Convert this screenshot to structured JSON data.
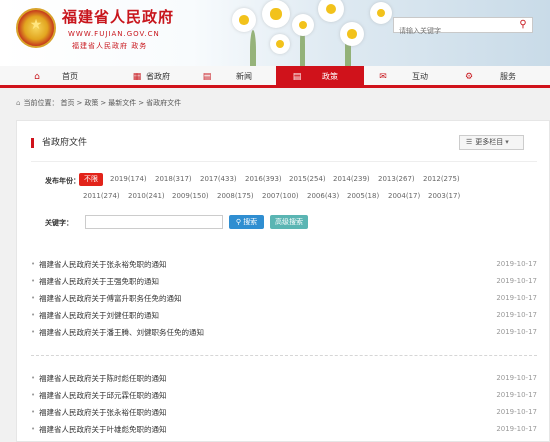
{
  "header": {
    "title": "福建省人民政府",
    "url_text": "WWW.FUJIAN.GOV.CN",
    "subtitle": "福建省人民政府 政务",
    "search_placeholder": "请输入关键字",
    "accent_color": "#d0121b"
  },
  "nav": [
    {
      "label": "首页",
      "icon": "home-icon"
    },
    {
      "label": "省政府",
      "icon": "building-icon"
    },
    {
      "label": "新闻",
      "icon": "news-icon"
    },
    {
      "label": "政策",
      "icon": "policy-icon",
      "active": true
    },
    {
      "label": "互动",
      "icon": "chat-icon"
    },
    {
      "label": "服务",
      "icon": "service-icon"
    }
  ],
  "breadcrumb": {
    "prefix": "当前位置：",
    "items": [
      "首页",
      ">",
      "政策",
      ">",
      "最新文件",
      ">",
      "省政府文件"
    ]
  },
  "panel": {
    "title": "省政府文件",
    "more_label": "更多栏目",
    "filter_label": "发布年份：",
    "years_row1": [
      "不限",
      "2019(174)",
      "2018(317)",
      "2017(433)",
      "2016(393)",
      "2015(254)",
      "2014(239)",
      "2013(267)",
      "2012(275)"
    ],
    "years_row2": [
      "2011(274)",
      "2010(241)",
      "2009(150)",
      "2008(175)",
      "2007(100)",
      "2006(43)",
      "2005(18)",
      "2004(17)",
      "2003(17)"
    ],
    "keyword_label": "关键字：",
    "search_btn": "搜索",
    "advanced_btn": "高级搜索"
  },
  "list_group1": [
    {
      "title": "福建省人民政府关于张永裕免职的通知",
      "date": "2019-10-17"
    },
    {
      "title": "福建省人民政府关于王强免职的通知",
      "date": "2019-10-17"
    },
    {
      "title": "福建省人民政府关于傅富升职务任免的通知",
      "date": "2019-10-17"
    },
    {
      "title": "福建省人民政府关于刘健任职的通知",
      "date": "2019-10-17"
    },
    {
      "title": "福建省人民政府关于潘王腾、刘健职务任免的通知",
      "date": "2019-10-17"
    }
  ],
  "list_group2": [
    {
      "title": "福建省人民政府关于陈时彪任职的通知",
      "date": "2019-10-17"
    },
    {
      "title": "福建省人民政府关于邱元霖任职的通知",
      "date": "2019-10-17"
    },
    {
      "title": "福建省人民政府关于张永裕任职的通知",
      "date": "2019-10-17"
    },
    {
      "title": "福建省人民政府关于叶雄彪免职的通知",
      "date": "2019-10-17"
    }
  ]
}
